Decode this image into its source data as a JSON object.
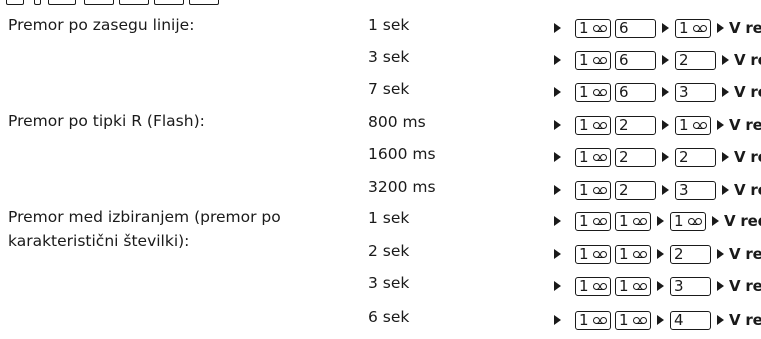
{
  "labels": [
    "Premor po zasegu linije:",
    "Premor po tipki R (Flash):",
    "Premor med izbiranjem (premor po",
    "karakteristični številki):"
  ],
  "rows": [
    {
      "value": "1 sek",
      "keys": [
        "1",
        "6"
      ],
      "final": "1",
      "confirm": "V redu"
    },
    {
      "value": "3 sek",
      "keys": [
        "1",
        "6"
      ],
      "final": "2",
      "confirm": "V redu"
    },
    {
      "value": "7 sek",
      "keys": [
        "1",
        "6"
      ],
      "final": "3",
      "confirm": "V redu"
    },
    {
      "value": "800 ms",
      "keys": [
        "1",
        "2"
      ],
      "final": "1",
      "confirm": "V redu"
    },
    {
      "value": "1600 ms",
      "keys": [
        "1",
        "2"
      ],
      "final": "2",
      "confirm": "V redu"
    },
    {
      "value": "3200 ms",
      "keys": [
        "1",
        "2"
      ],
      "final": "3",
      "confirm": "V redu"
    },
    {
      "value": "1 sek",
      "keys": [
        "1",
        "1"
      ],
      "final": "1",
      "confirm": "V redu"
    },
    {
      "value": "2 sek",
      "keys": [
        "1",
        "1"
      ],
      "final": "2",
      "confirm": "V redu"
    },
    {
      "value": "3 sek",
      "keys": [
        "1",
        "1"
      ],
      "final": "3",
      "confirm": "V redu"
    },
    {
      "value": "6 sek",
      "keys": [
        "1",
        "1"
      ],
      "final": "4",
      "confirm": "V redu"
    }
  ],
  "icons": {
    "arrow": "right-triangle-icon",
    "voicemail": "voicemail-icon"
  },
  "colors": {
    "text": "#1a1a1a",
    "background": "#ffffff"
  }
}
